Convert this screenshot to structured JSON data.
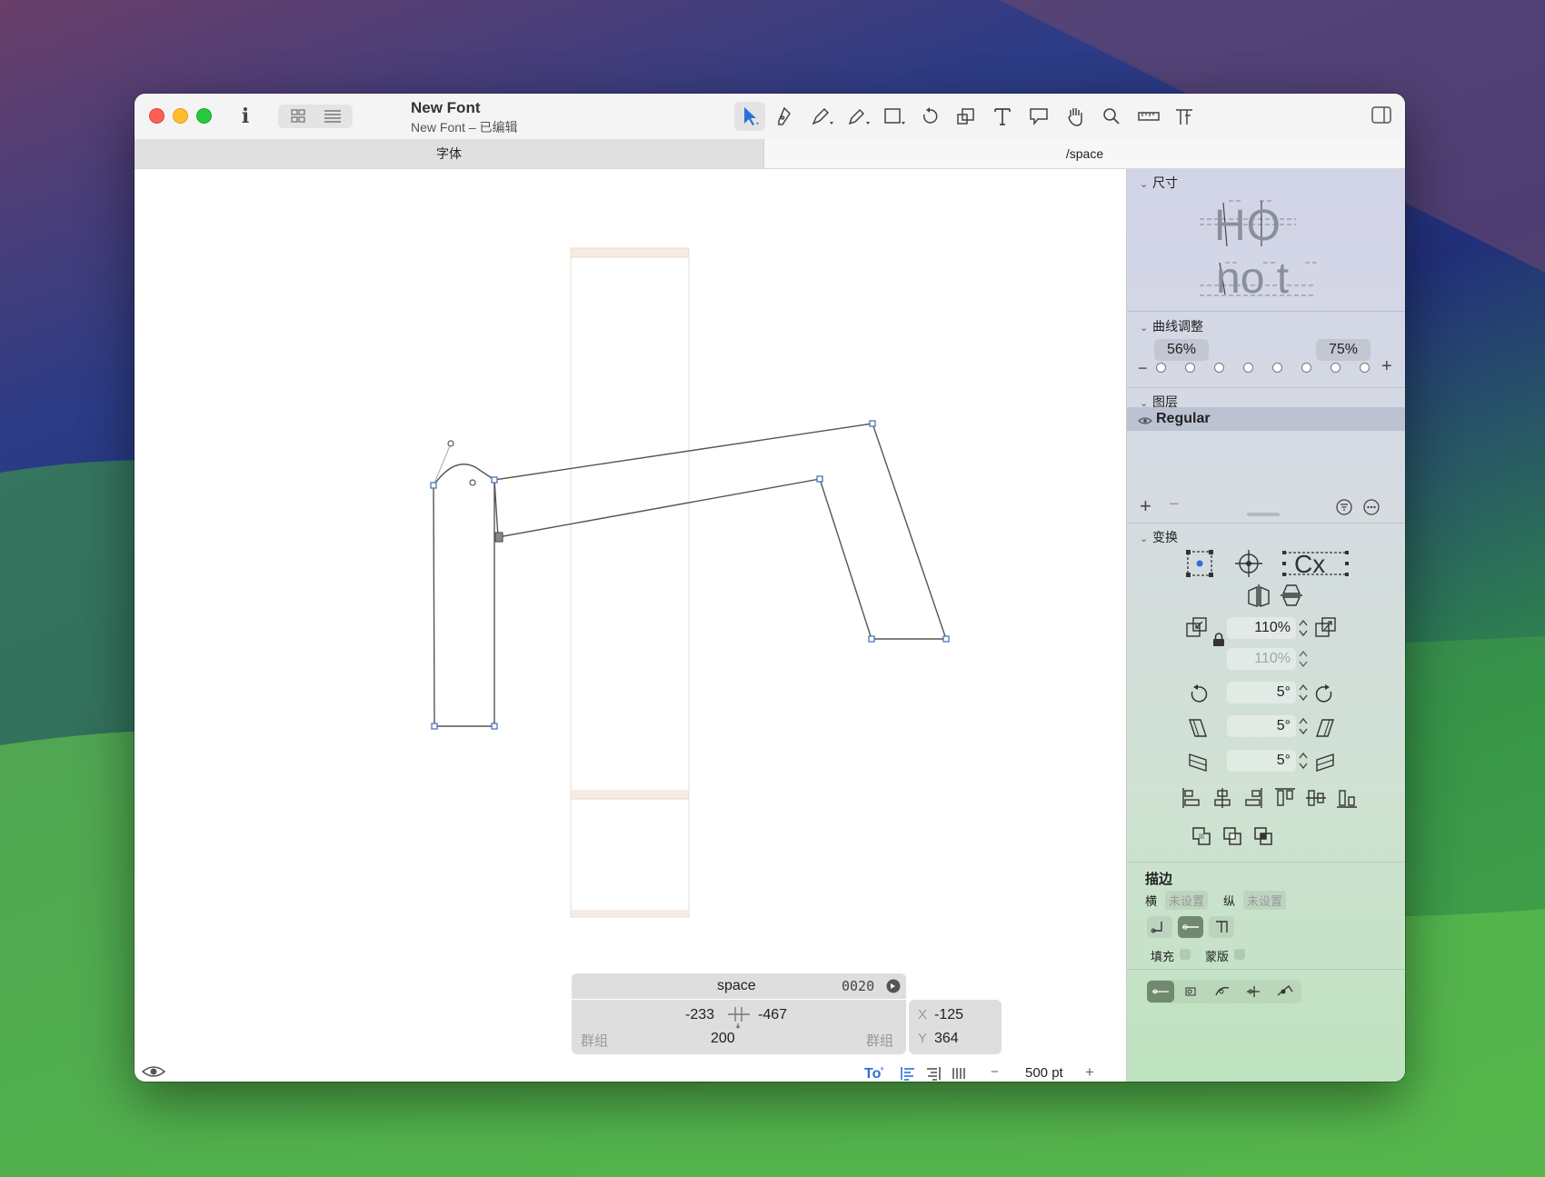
{
  "window": {
    "title": "New Font",
    "subtitle": "New Font – 已编辑"
  },
  "toolbar": {
    "tools": [
      "select-tool-icon",
      "pen-tool-icon",
      "draw-tool-icon",
      "pencil-tool-icon",
      "rectangle-tool-icon",
      "rotate-tool-icon",
      "scale-tool-icon",
      "text-tool-icon",
      "annotation-tool-icon",
      "hand-tool-icon",
      "zoom-tool-icon",
      "measure-tool-icon",
      "type-tool-icon"
    ],
    "active_tool": "select-tool-icon",
    "accent": "#2a6fdb"
  },
  "tabs": [
    {
      "label": "字体"
    },
    {
      "label": "/space"
    }
  ],
  "glyph_info": {
    "name": "space",
    "unicode": "0020",
    "lsb": "-233",
    "rsb": "-467",
    "width": "200",
    "left_group": "群组",
    "right_group": "群组",
    "x_label": "X",
    "x_value": "-125",
    "y_label": "Y",
    "y_value": "364"
  },
  "bottombar": {
    "zoom_minus": "−",
    "zoom_value": "500 pt",
    "zoom_plus": "+"
  },
  "inspector": {
    "dimensions": {
      "title": "尺寸",
      "preview_line1": "HO",
      "preview_line2": "no t"
    },
    "curvature": {
      "title": "曲线调整",
      "left_value": "56%",
      "right_value": "75%",
      "minus": "−",
      "plus": "+"
    },
    "layers": {
      "title": "图层",
      "items": [
        {
          "name": "Regular"
        }
      ],
      "add": "+",
      "remove": "−"
    },
    "transform": {
      "title": "变换",
      "scale_x": "110%",
      "scale_y": "110%",
      "rotate": "5°",
      "slant_x": "5°",
      "slant_y": "5°"
    },
    "stroke": {
      "title": "描边",
      "horizontal_label": "横",
      "horizontal_value": "未设置",
      "vertical_label": "纵",
      "vertical_value": "未设置",
      "fill_label": "填充",
      "mask_label": "蒙版"
    }
  }
}
